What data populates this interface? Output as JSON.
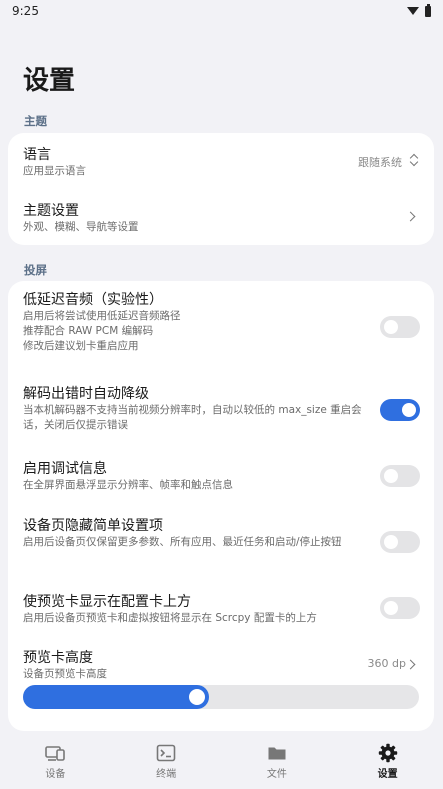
{
  "status_bar": {
    "time": "9:25"
  },
  "page_title": "设置",
  "sections": {
    "theme": {
      "label": "主题",
      "language": {
        "title": "语言",
        "desc": "应用显示语言",
        "value": "跟随系统"
      },
      "theme_settings": {
        "title": "主题设置",
        "desc": "外观、模糊、导航等设置"
      }
    },
    "mirror": {
      "label": "投屏",
      "low_latency_audio": {
        "title": "低延迟音频（实验性）",
        "desc_lines": [
          "启用后将尝试使用低延迟音频路径",
          "推荐配合 RAW PCM 编解码",
          "修改后建议划卡重启应用"
        ],
        "enabled": false
      },
      "auto_downgrade": {
        "title": "解码出错时自动降级",
        "desc": "当本机解码器不支持当前视频分辨率时，自动以较低的 max_size 重启会话，关闭后仅提示错误",
        "enabled": true
      },
      "debug_info": {
        "title": "启用调试信息",
        "desc": "在全屏界面悬浮显示分辨率、帧率和触点信息",
        "enabled": false
      },
      "hide_simple_settings": {
        "title": "设备页隐藏简单设置项",
        "desc": "启用后设备页仅保留更多参数、所有应用、最近任务和启动/停止按钮",
        "enabled": false
      },
      "preview_on_top": {
        "title": "使预览卡显示在配置卡上方",
        "desc": "启用后设备页预览卡和虚拟按钮将显示在 Scrcpy 配置卡的上方",
        "enabled": false
      },
      "preview_height": {
        "title": "预览卡高度",
        "desc": "设备页预览卡高度",
        "value": "360 dp",
        "slider_fraction": 0.47
      }
    }
  },
  "bottom_nav": {
    "items": [
      {
        "label": "设备",
        "icon": "devices-icon"
      },
      {
        "label": "终端",
        "icon": "terminal-icon"
      },
      {
        "label": "文件",
        "icon": "folder-icon"
      },
      {
        "label": "设置",
        "icon": "gear-icon",
        "active": true
      }
    ]
  },
  "colors": {
    "accent": "#2f6fe0",
    "background": "#f2f2f6",
    "card": "#ffffff"
  }
}
